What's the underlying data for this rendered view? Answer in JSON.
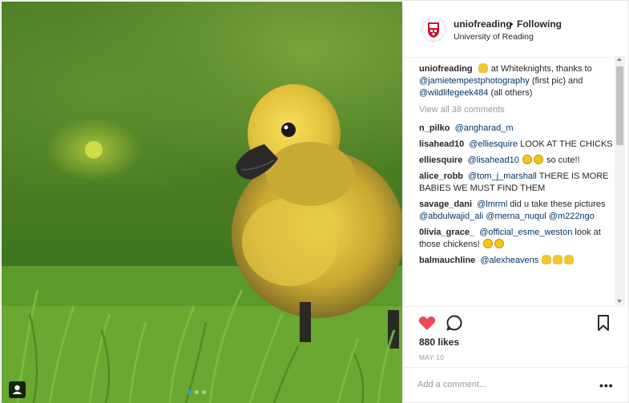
{
  "post": {
    "username": "uniofreading",
    "separator": "•",
    "follow_status": "Following",
    "location": "University of Reading",
    "caption": {
      "user": "uniofreading",
      "text_before": "at Whiteknights, thanks to",
      "mention_1": "@jamietempestphotography",
      "text_middle": "(first pic) and",
      "mention_2": "@wildlifegeek484",
      "text_after": "(all others)"
    },
    "view_all": "View all 38 comments",
    "comments": [
      {
        "user": "n_pilko",
        "mention": "@angharad_m",
        "text": ""
      },
      {
        "user": "lisahead10",
        "mention": "@elliesquire",
        "text": "LOOK AT THE CHICKS"
      },
      {
        "user": "elliesquire",
        "mention": "@lisahead10",
        "text": "so cute!!"
      },
      {
        "user": "alice_robb",
        "mention": "@tom_j_marshall",
        "text": "THERE IS MORE BABIES WE MUST FIND THEM"
      },
      {
        "user": "savage_dani",
        "mention": "@lmrml",
        "text": "did u take these pictures"
      },
      {
        "user": "0livia_grace_",
        "mention": "@official_esme_weston",
        "text": "look at those chickens!"
      },
      {
        "user": "balmauchline",
        "mention": "@alexheavens",
        "text": ""
      }
    ],
    "savage_extra_mentions": [
      "@abdulwajid_ali",
      "@merna_nuqul",
      "@m222ngo"
    ],
    "likes": "880 likes",
    "date": "MAY 10",
    "add_comment_placeholder": "Add a comment...",
    "more_label": "•••"
  },
  "colors": {
    "like_red": "#ed4956",
    "mention_blue": "#003569",
    "muted_gray": "#999999",
    "active_dot": "#3897f0"
  },
  "icons": [
    "gosling-emoji",
    "heart-icon",
    "comment-icon",
    "bookmark-icon",
    "user-tag-icon",
    "university-crest-icon",
    "crying-emoji",
    "grinning-emoji",
    "chick-emoji"
  ]
}
